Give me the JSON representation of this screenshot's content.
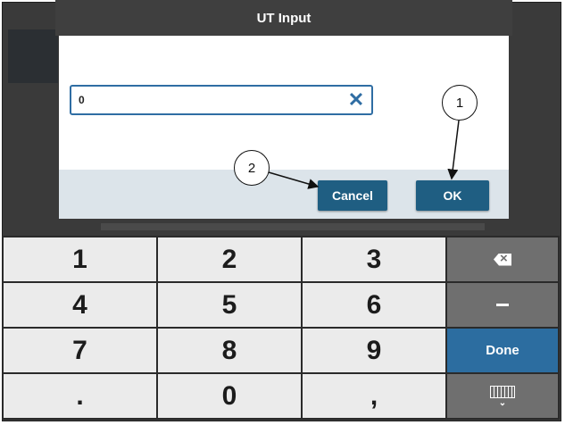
{
  "dialog": {
    "title": "UT Input",
    "input_value": "0",
    "cancel_label": "Cancel",
    "ok_label": "OK"
  },
  "callouts": {
    "one": "1",
    "two": "2"
  },
  "keypad": {
    "keys": [
      "1",
      "2",
      "3",
      "4",
      "5",
      "6",
      "7",
      "8",
      "9",
      ".",
      "0",
      ","
    ],
    "done_label": "Done"
  },
  "colors": {
    "accent": "#2c6da0",
    "button": "#1f5e82"
  }
}
